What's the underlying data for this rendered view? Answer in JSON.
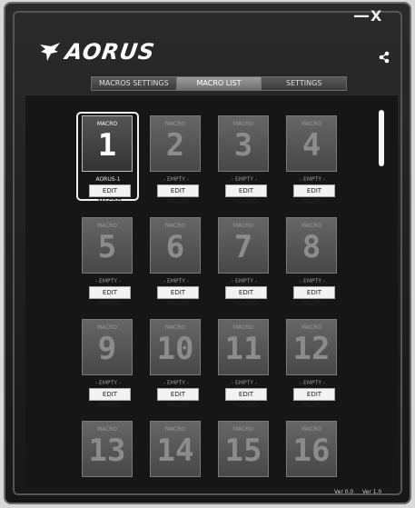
{
  "window": {
    "minimize_label": "—",
    "close_label": "X"
  },
  "brand": {
    "wordmark": "AORUS"
  },
  "tabs": [
    {
      "label": "MACROS SETTINGS",
      "active": false
    },
    {
      "label": "MACRO LIST",
      "active": true
    },
    {
      "label": "SETTINGS",
      "active": false
    }
  ],
  "macros": [
    {
      "tag": "MACRO",
      "number": "1",
      "sub": "AORUS-1",
      "button": "EDIT MACRO",
      "selected": true
    },
    {
      "tag": "MACRO",
      "number": "2",
      "sub": "- EMPTY -",
      "button": "EDIT MACRO",
      "selected": false
    },
    {
      "tag": "MACRO",
      "number": "3",
      "sub": "- EMPTY -",
      "button": "EDIT MACRO",
      "selected": false
    },
    {
      "tag": "MACRO",
      "number": "4",
      "sub": "- EMPTY -",
      "button": "EDIT MACRO",
      "selected": false
    },
    {
      "tag": "MACRO",
      "number": "5",
      "sub": "- EMPTY -",
      "button": "EDIT MACRO",
      "selected": false
    },
    {
      "tag": "MACRO",
      "number": "6",
      "sub": "- EMPTY -",
      "button": "EDIT MACRO",
      "selected": false
    },
    {
      "tag": "MACRO",
      "number": "7",
      "sub": "- EMPTY -",
      "button": "EDIT MACRO",
      "selected": false
    },
    {
      "tag": "MACRO",
      "number": "8",
      "sub": "- EMPTY -",
      "button": "EDIT MACRO",
      "selected": false
    },
    {
      "tag": "MACRO",
      "number": "9",
      "sub": "- EMPTY -",
      "button": "EDIT MACRO",
      "selected": false
    },
    {
      "tag": "MACRO",
      "number": "10",
      "sub": "- EMPTY -",
      "button": "EDIT MACRO",
      "selected": false
    },
    {
      "tag": "MACRO",
      "number": "11",
      "sub": "- EMPTY -",
      "button": "EDIT MACRO",
      "selected": false
    },
    {
      "tag": "MACRO",
      "number": "12",
      "sub": "- EMPTY -",
      "button": "EDIT MACRO",
      "selected": false
    },
    {
      "tag": "MACRO",
      "number": "13",
      "sub": "",
      "button": "",
      "selected": false
    },
    {
      "tag": "MACRO",
      "number": "14",
      "sub": "",
      "button": "",
      "selected": false
    },
    {
      "tag": "MACRO",
      "number": "15",
      "sub": "",
      "button": "",
      "selected": false
    },
    {
      "tag": "MACRO",
      "number": "16",
      "sub": "",
      "button": "",
      "selected": false
    }
  ],
  "footer": {
    "fw_version": "Ver 0.0",
    "sw_version": "Ver 1.0"
  }
}
